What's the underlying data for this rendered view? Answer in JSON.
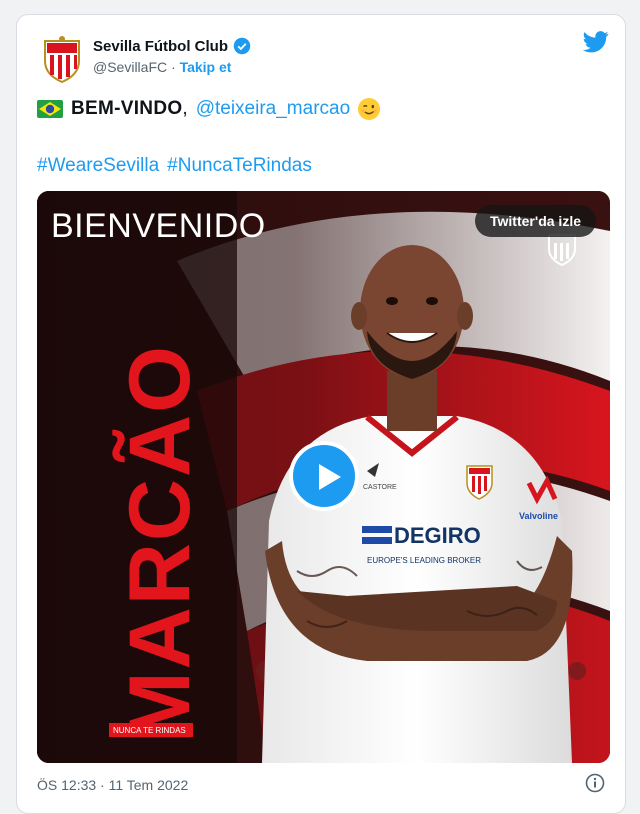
{
  "account": {
    "name": "Sevilla Fútbol Club",
    "handle": "@SevillaFC",
    "separator": "·",
    "follow_label": "Takip et"
  },
  "tweet": {
    "flag_icon": "brazil-flag-icon",
    "welcome": "BEM-VINDO",
    "comma": ",",
    "mention": "@teixeira_marcao",
    "emoji_icon": "winking-face-icon",
    "hashtags": [
      "#WeareSevilla",
      "#NuncaTeRindas"
    ]
  },
  "media": {
    "heading": "BIENVENIDO",
    "player_name": "MARCÃO",
    "tagline": "NUNCA TE RINDAS",
    "watch_label": "Twitter'da izle",
    "sponsor_main": "DEGIRO",
    "sponsor_sub": "EUROPE'S LEADING BROKER",
    "sleeve_sponsor": "Valvoline",
    "kit_brand": "CASTORE"
  },
  "footer": {
    "timestamp": "ÖS 12:33 · 11 Tem 2022"
  },
  "colors": {
    "accent": "#1d9bf0",
    "club_red": "#d8151e",
    "text": "#0f1419",
    "muted": "#536471"
  }
}
